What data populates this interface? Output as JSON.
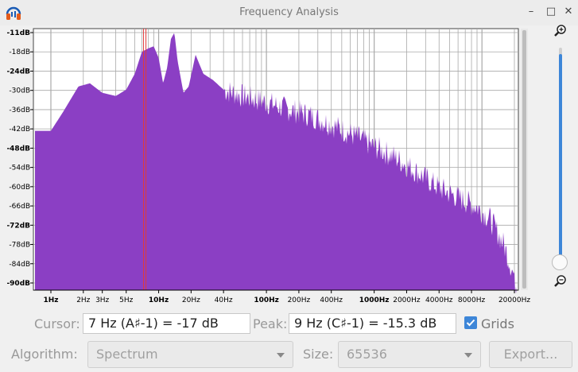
{
  "window": {
    "title": "Frequency Analysis",
    "controls": {
      "minimize": "–",
      "maximize": "□",
      "close": "✕"
    }
  },
  "colors": {
    "spectrum_fill": "#8b3fc4",
    "cursor_line": "#e03a3a",
    "grid": "#a9a9a9",
    "accent": "#3d86d8"
  },
  "plot": {
    "y_axis": {
      "labels": [
        "-11dB",
        "-18dB",
        "-24dB",
        "-30dB",
        "-36dB",
        "-42dB",
        "-48dB",
        "-54dB",
        "-60dB",
        "-66dB",
        "-72dB",
        "-78dB",
        "-84dB",
        "-90dB"
      ],
      "bold": [
        "-11dB",
        "-24dB",
        "-48dB",
        "-72dB",
        "-90dB"
      ]
    },
    "x_axis": {
      "labels": [
        "1Hz",
        "2Hz",
        "3Hz",
        "5Hz",
        "10Hz",
        "20Hz",
        "40Hz",
        "100Hz",
        "200Hz",
        "400Hz",
        "1000Hz",
        "2000Hz",
        "4000Hz",
        "8000Hz",
        "20000Hz"
      ],
      "bold": [
        "1Hz",
        "10Hz",
        "100Hz",
        "1000Hz"
      ]
    }
  },
  "cursor": {
    "label": "Cursor:",
    "value": "7 Hz (A♯-1) = -17 dB"
  },
  "peak": {
    "label": "Peak:",
    "value": "9 Hz (C♯-1) = -15.3 dB"
  },
  "grids": {
    "label": "Grids",
    "checked": true
  },
  "algorithm": {
    "label": "Algorithm:",
    "value": "Spectrum"
  },
  "size": {
    "label": "Size:",
    "value": "65536"
  },
  "export_button": "Export...",
  "icons": {
    "app": "audacity-headphones-icon",
    "zoom_in": "magnifier-plus-icon",
    "zoom_out": "magnifier-minus-icon",
    "check": "checkmark-icon"
  }
}
